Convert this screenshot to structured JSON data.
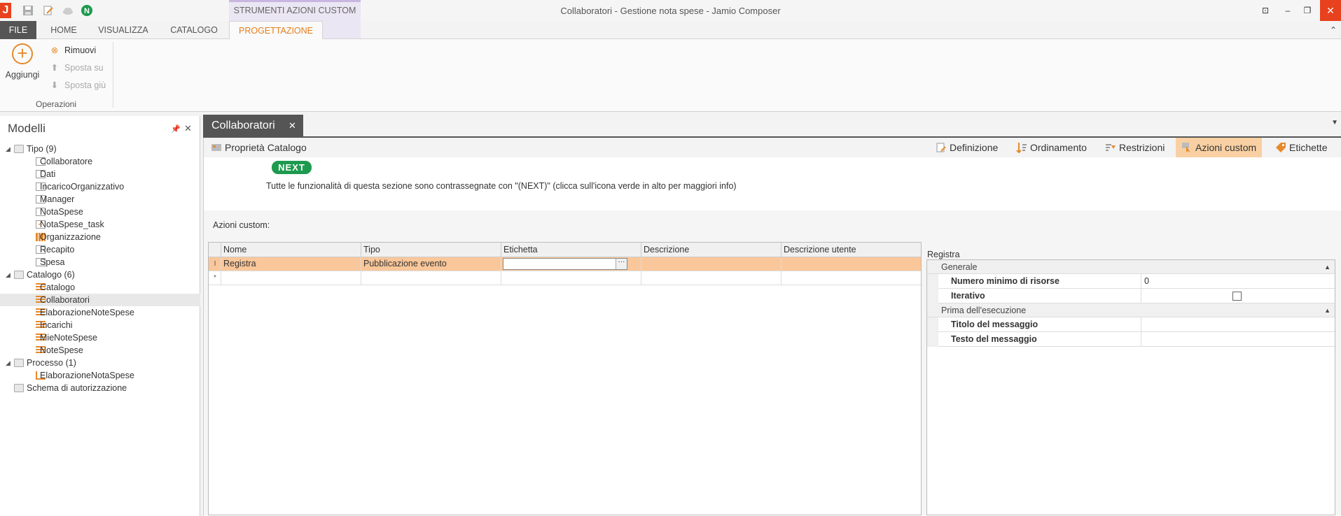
{
  "window": {
    "title": "Collaboratori - Gestione nota spese - Jamio Composer",
    "context_group": "STRUMENTI AZIONI CUSTOM",
    "logo": "J",
    "controls": {
      "restore_ribbon": "⊡",
      "minimize": "–",
      "maximize": "❐",
      "close": "✕"
    }
  },
  "quick_access": [
    {
      "icon": "save-icon"
    },
    {
      "icon": "edit-icon"
    },
    {
      "icon": "cloud-icon"
    },
    {
      "icon": "next-icon",
      "label": "N"
    }
  ],
  "ribbon": {
    "tabs": [
      {
        "label": "FILE"
      },
      {
        "label": "HOME"
      },
      {
        "label": "VISUALIZZA"
      },
      {
        "label": "CATALOGO"
      },
      {
        "label": "PROGETTAZIONE",
        "active": true
      }
    ],
    "add_label": "Aggiungi",
    "remove_label": "Rimuovi",
    "move_up_label": "Sposta su",
    "move_down_label": "Sposta giù",
    "group_label": "Operazioni"
  },
  "left_panel": {
    "title": "Modelli",
    "tree": [
      {
        "level": 0,
        "label": "Tipo (9)",
        "expanded": true,
        "icon": "folder-icon"
      },
      {
        "level": 1,
        "label": "Collaboratore",
        "icon": "entity-icon"
      },
      {
        "level": 1,
        "label": "Dati",
        "icon": "entity-icon"
      },
      {
        "level": 1,
        "label": "IncaricoOrganizzativo",
        "icon": "entity-icon"
      },
      {
        "level": 1,
        "label": "Manager",
        "icon": "entity-icon"
      },
      {
        "level": 1,
        "label": "NotaSpese",
        "icon": "entity-icon"
      },
      {
        "level": 1,
        "label": "NotaSpese_task",
        "icon": "task-icon"
      },
      {
        "level": 1,
        "label": "Organizzazione",
        "icon": "grid-icon"
      },
      {
        "level": 1,
        "label": "Recapito",
        "icon": "entity-icon"
      },
      {
        "level": 1,
        "label": "Spesa",
        "icon": "entity-icon"
      },
      {
        "level": 0,
        "label": "Catalogo (6)",
        "expanded": true,
        "icon": "folder-icon"
      },
      {
        "level": 1,
        "label": "Catalogo",
        "icon": "list-icon"
      },
      {
        "level": 1,
        "label": "Collaboratori",
        "icon": "list-icon",
        "selected": true
      },
      {
        "level": 1,
        "label": "ElaborazioneNoteSpese",
        "icon": "list-icon"
      },
      {
        "level": 1,
        "label": "Incarichi",
        "icon": "list-icon"
      },
      {
        "level": 1,
        "label": "MieNoteSpese",
        "icon": "list-icon"
      },
      {
        "level": 1,
        "label": "NoteSpese",
        "icon": "list-icon"
      },
      {
        "level": 0,
        "label": "Processo (1)",
        "expanded": true,
        "icon": "folder-icon"
      },
      {
        "level": 1,
        "label": "ElaborazioneNotaSpese",
        "icon": "process-icon"
      },
      {
        "level": 0,
        "label": "Schema di autorizzazione",
        "expanded": false,
        "icon": "folder-icon"
      }
    ]
  },
  "document": {
    "tab_label": "Collaboratori",
    "toolbar": {
      "catalog_props": "Proprietà Catalogo",
      "definition": "Definizione",
      "ordering": "Ordinamento",
      "restrictions": "Restrizioni",
      "custom_actions": "Azioni custom",
      "labels": "Etichette"
    },
    "next_badge": "NEXT",
    "next_text": "Tutte le funzionalità di questa sezione sono contrassegnate con \"(NEXT)\" (clicca sull'icona verde in alto per maggiori info)",
    "section_label": "Azioni custom:",
    "grid": {
      "columns": [
        "Nome",
        "Tipo",
        "Etichetta",
        "Descrizione",
        "Descrizione utente"
      ],
      "rows": [
        {
          "indicator": "I",
          "cells": [
            "Registra",
            "Pubblicazione evento",
            "",
            "",
            ""
          ]
        }
      ],
      "new_row_indicator": "*"
    },
    "properties": {
      "title": "Registra",
      "categories": [
        {
          "label": "Generale",
          "rows": [
            {
              "name": "Numero minimo di risorse",
              "value": "0"
            },
            {
              "name": "Iterativo",
              "value": "",
              "type": "checkbox",
              "checked": false
            }
          ]
        },
        {
          "label": "Prima dell'esecuzione",
          "rows": [
            {
              "name": "Titolo del messaggio",
              "value": ""
            },
            {
              "name": "Testo del messaggio",
              "value": ""
            }
          ]
        }
      ]
    }
  },
  "colors": {
    "accent_orange": "#e57d1a",
    "selection": "#fac79a",
    "active_tool": "#f9d0a3",
    "next_green": "#1e9a4e",
    "close_red": "#e8411d"
  }
}
